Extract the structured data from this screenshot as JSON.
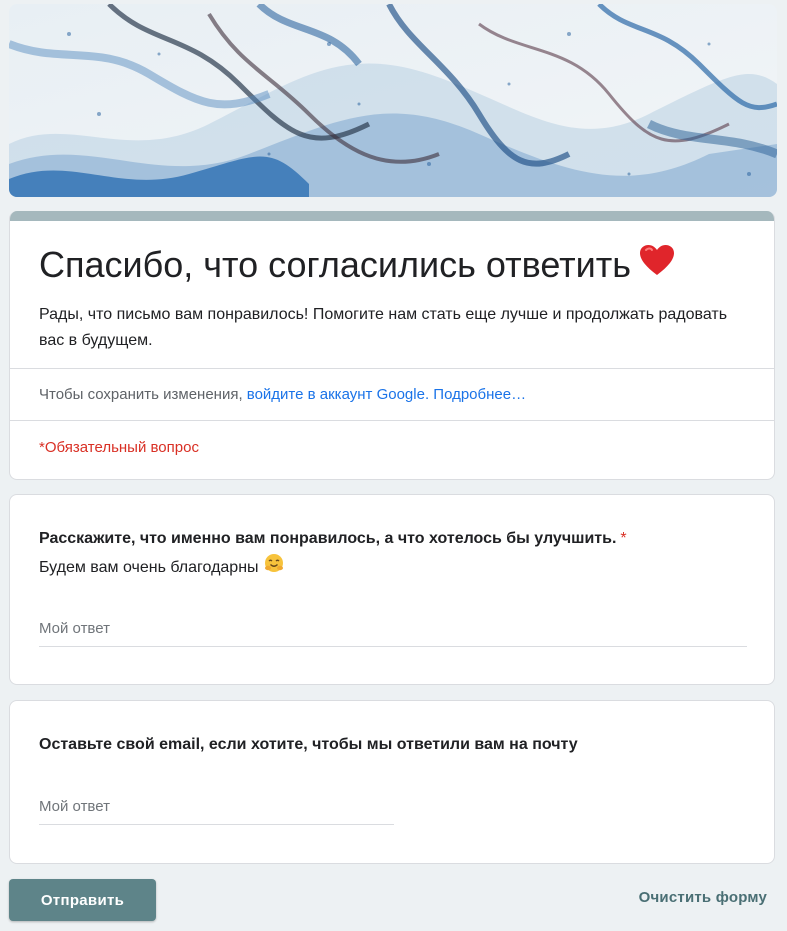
{
  "colors": {
    "background": "#edf1f3",
    "accent_bar": "#a5b8bd",
    "button": "#5e8489",
    "link": "#1a73e8",
    "required": "#d93025"
  },
  "banner": {
    "image": "blue-white-marble-watercolor-banner"
  },
  "header": {
    "title": "Спасибо, что согласились ответить",
    "title_emoji": "red-heart-icon",
    "description": "Рады, что письмо вам понравилось! Помогите нам стать еще лучше и продолжать радовать вас в будущем.",
    "signin_prefix": "Чтобы сохранить изменения, ",
    "signin_link": "войдите в аккаунт Google.",
    "learn_more_link": "Подробнее…",
    "required_note": "*Обязательный вопрос"
  },
  "questions": [
    {
      "title": "Расскажите, что именно вам понравилось, а что хотелось бы улучшить.",
      "required_mark": "*",
      "subtitle": "Будем вам очень благодарны",
      "subtitle_emoji": "hugging-face-icon",
      "placeholder": "Мой ответ"
    },
    {
      "title": "Оставьте свой email, если хотите, чтобы мы ответили вам на почту",
      "placeholder": "Мой ответ"
    }
  ],
  "actions": {
    "submit_label": "Отправить",
    "clear_label": "Очистить форму"
  }
}
